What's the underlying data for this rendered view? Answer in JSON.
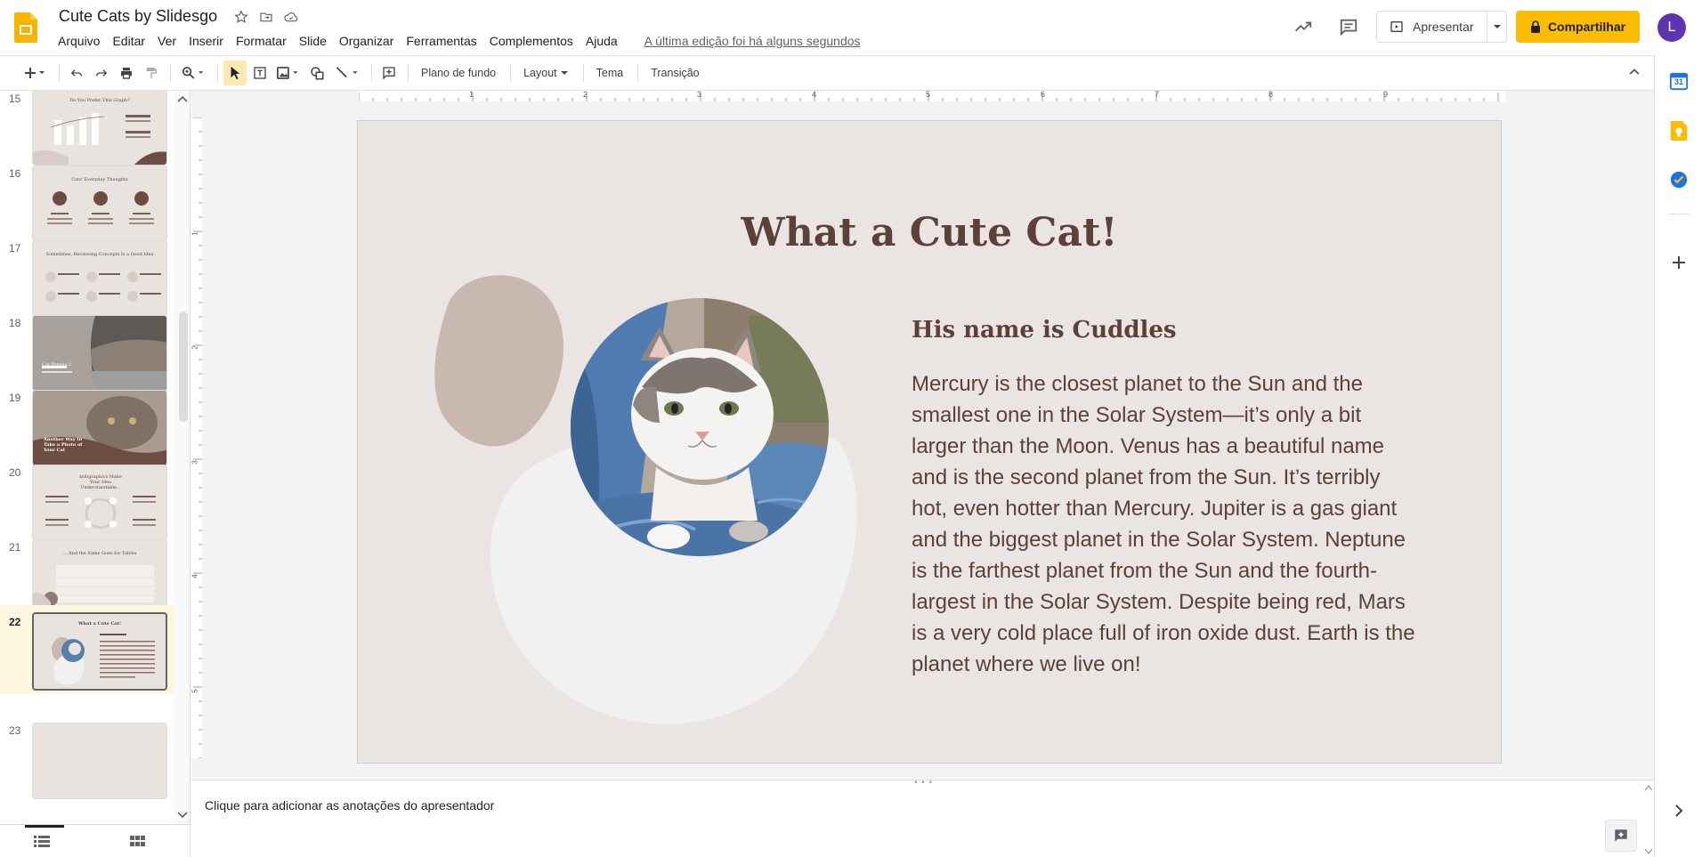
{
  "header": {
    "doc_title": "Cute Cats by Slidesgo",
    "menu": [
      "Arquivo",
      "Editar",
      "Ver",
      "Inserir",
      "Formatar",
      "Slide",
      "Organizar",
      "Ferramentas",
      "Complementos",
      "Ajuda"
    ],
    "last_edit": "A última edição foi há alguns segundos",
    "present_label": "Apresentar",
    "share_label": "Compartilhar",
    "avatar_initial": "L"
  },
  "toolbar": {
    "background_label": "Plano de fundo",
    "layout_label": "Layout",
    "theme_label": "Tema",
    "transition_label": "Transição"
  },
  "filmstrip": {
    "slides": [
      {
        "number": "15",
        "title": "Do You Prefer This Graph?"
      },
      {
        "number": "16",
        "title": "Cats' Everyday Thoughts"
      },
      {
        "number": "17",
        "title": "Sometimes, Reviewing Concepts Is a Good Idea"
      },
      {
        "number": "18",
        "title": "Cat Breeds 2"
      },
      {
        "number": "19",
        "title": "Another Way to Take a Photo of Your Cat"
      },
      {
        "number": "20",
        "title": "Infographics Make Your Idea Understandable..."
      },
      {
        "number": "21",
        "title": "... And the Same Goes for Tables"
      },
      {
        "number": "22",
        "title": "What a Cute Cat!"
      },
      {
        "number": "23",
        "title": ""
      }
    ],
    "selected": "22"
  },
  "ruler": {
    "h_labels": [
      "1",
      "2",
      "3",
      "4",
      "5",
      "6",
      "7",
      "8",
      "9"
    ],
    "v_labels": [
      "1",
      "2",
      "3",
      "4",
      "5"
    ]
  },
  "slide": {
    "title": "What a Cute Cat!",
    "subtitle": "His name is Cuddles",
    "body": "Mercury is the closest planet to the Sun and the smallest one in the Solar System—it’s only a bit larger than the Moon. Venus has a beautiful name and is the second planet from the Sun. It’s terribly hot, even hotter than Mercury. Jupiter is a gas giant and the biggest planet in the Solar System. Neptune is the farthest planet from the Sun and the fourth-largest in the Solar System. Despite being red, Mars is a very cold place full of iron oxide dust. Earth is the planet where we live on!"
  },
  "notes": {
    "placeholder": "Clique para adicionar as anotações do apresentador"
  },
  "side_panel": {
    "calendar_day": "31"
  },
  "colors": {
    "accent": "#fbbc04",
    "title_brown": "#5d4037",
    "slide_bg": "#eae5e2",
    "blob_tan": "#c9b8b0",
    "blob_light": "#f1f1f1"
  }
}
